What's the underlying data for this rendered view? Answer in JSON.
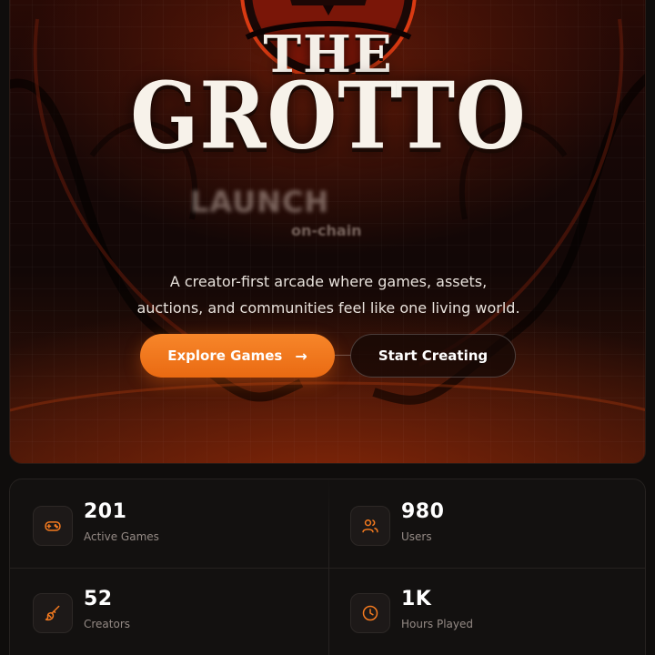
{
  "hero": {
    "logo_the": "THE",
    "logo_grotto": "GROTTO",
    "launch_text": "LAUNCH",
    "onchain_text": "on-chain",
    "tagline_line1": "A creator-first arcade where games, assets,",
    "tagline_line2": "auctions, and communities feel like one living world.",
    "explore_label": "Explore Games",
    "explore_arrow": "→",
    "create_label": "Start Creating"
  },
  "stats": [
    {
      "value": "201",
      "label": "Active Games",
      "icon": "gamepad-icon"
    },
    {
      "value": "980",
      "label": "Users",
      "icon": "users-icon"
    },
    {
      "value": "52",
      "label": "Creators",
      "icon": "paintbrush-icon"
    },
    {
      "value": "1K",
      "label": "Hours Played",
      "icon": "clock-icon"
    }
  ],
  "colors": {
    "accent": "#f47a1f",
    "background": "#0f0d0c",
    "panel": "#131110"
  }
}
